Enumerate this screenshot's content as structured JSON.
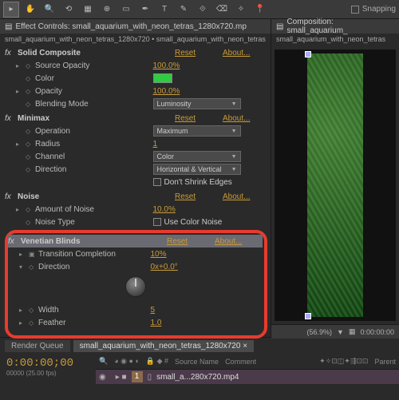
{
  "toolbar": {
    "snapping": "Snapping"
  },
  "panels": {
    "effectControls": {
      "title": "Effect Controls: small_aquarium_with_neon_tetras_1280x720.mp",
      "path": "small_aquarium_with_neon_tetras_1280x720 • small_aquarium_with_neon_tetras"
    },
    "composition": {
      "title": "Composition: small_aquarium_",
      "path": "small_aquarium_with_neon_tetras"
    }
  },
  "labels": {
    "reset": "Reset",
    "about": "About..."
  },
  "effects": {
    "solidComposite": {
      "name": "Solid Composite",
      "sourceOpacity": {
        "name": "Source Opacity",
        "value": "100.0%"
      },
      "color": {
        "name": "Color"
      },
      "opacity": {
        "name": "Opacity",
        "value": "100.0%"
      },
      "blendingMode": {
        "name": "Blending Mode",
        "value": "Luminosity"
      }
    },
    "minimax": {
      "name": "Minimax",
      "operation": {
        "name": "Operation",
        "value": "Maximum"
      },
      "radius": {
        "name": "Radius",
        "value": "1"
      },
      "channel": {
        "name": "Channel",
        "value": "Color"
      },
      "direction": {
        "name": "Direction",
        "value": "Horizontal & Vertical"
      },
      "dontShrink": {
        "label": "Don't Shrink Edges"
      }
    },
    "noise": {
      "name": "Noise",
      "amount": {
        "name": "Amount of Noise",
        "value": "10.0%"
      },
      "type": {
        "name": "Noise Type",
        "label": "Use Color Noise"
      }
    },
    "venetian": {
      "name": "Venetian Blinds",
      "completion": {
        "name": "Transition Completion",
        "value": "10%"
      },
      "direction": {
        "name": "Direction",
        "value": "0x+0.0°"
      },
      "width": {
        "name": "Width",
        "value": "5"
      },
      "feather": {
        "name": "Feather",
        "value": "1.0"
      }
    }
  },
  "preview": {
    "zoom": "(56.9%)",
    "time": "0:00:00:00"
  },
  "timeline": {
    "renderQueue": "Render Queue",
    "tab": "small_aquarium_with_neon_tetras_1280x720",
    "timecode": "0:00:00;00",
    "fps": "00000 (25.00 fps)",
    "headers": {
      "source": "Source Name",
      "comment": "Comment",
      "parent": "Parent"
    },
    "track": {
      "num": "1",
      "name": "small_a...280x720.mp4"
    }
  }
}
